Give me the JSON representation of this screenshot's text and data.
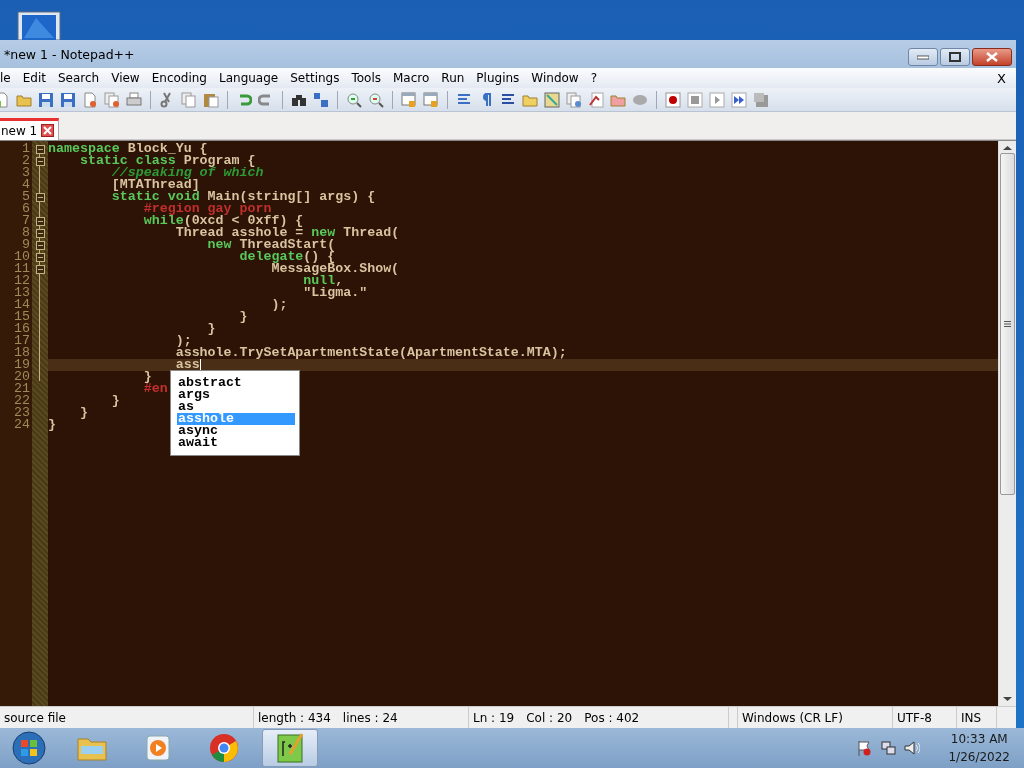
{
  "window": {
    "title": "*new 1 - Notepad++"
  },
  "menu": [
    "le",
    "Edit",
    "Search",
    "View",
    "Encoding",
    "Language",
    "Settings",
    "Tools",
    "Macro",
    "Run",
    "Plugins",
    "Window",
    "?"
  ],
  "close_document": "X",
  "tabs": [
    {
      "label": "new 1",
      "selected": true
    }
  ],
  "lines": [
    {
      "number": "1",
      "fold": true,
      "current": false,
      "tokens": [
        {
          "kind": "keyword",
          "text": "namespace"
        },
        {
          "kind": "plain",
          "text": " Block_Yu {"
        }
      ]
    },
    {
      "number": "2",
      "fold": true,
      "current": false,
      "tokens": [
        {
          "kind": "keyword",
          "text": "    static class"
        },
        {
          "kind": "plain",
          "text": " Program {"
        }
      ]
    },
    {
      "number": "3",
      "fold": false,
      "current": false,
      "tokens": [
        {
          "kind": "comment",
          "text": "        //speaking of which"
        }
      ]
    },
    {
      "number": "4",
      "fold": false,
      "current": false,
      "tokens": [
        {
          "kind": "plain",
          "text": "        [MTAThread]"
        }
      ]
    },
    {
      "number": "5",
      "fold": true,
      "current": false,
      "tokens": [
        {
          "kind": "keyword",
          "text": "        static void"
        },
        {
          "kind": "plain",
          "text": " Main(string[] args) {"
        }
      ]
    },
    {
      "number": "6",
      "fold": false,
      "current": false,
      "tokens": [
        {
          "kind": "preprocessor",
          "text": "            #region gay porn"
        }
      ]
    },
    {
      "number": "7",
      "fold": true,
      "current": false,
      "tokens": [
        {
          "kind": "keyword",
          "text": "            while"
        },
        {
          "kind": "plain",
          "text": "(0xcd < 0xff) {"
        }
      ]
    },
    {
      "number": "8",
      "fold": true,
      "current": false,
      "tokens": [
        {
          "kind": "plain",
          "text": "                Thread asshole = "
        },
        {
          "kind": "keyword",
          "text": "new"
        },
        {
          "kind": "plain",
          "text": " Thread("
        }
      ]
    },
    {
      "number": "9",
      "fold": true,
      "current": false,
      "tokens": [
        {
          "kind": "keyword",
          "text": "                    new"
        },
        {
          "kind": "plain",
          "text": " ThreadStart("
        }
      ]
    },
    {
      "number": "10",
      "fold": true,
      "current": false,
      "tokens": [
        {
          "kind": "keyword",
          "text": "                        delegate"
        },
        {
          "kind": "plain",
          "text": "() {"
        }
      ]
    },
    {
      "number": "11",
      "fold": true,
      "current": false,
      "tokens": [
        {
          "kind": "plain",
          "text": "                            MessageBox.Show("
        }
      ]
    },
    {
      "number": "12",
      "fold": false,
      "current": false,
      "tokens": [
        {
          "kind": "keyword",
          "text": "                                null"
        },
        {
          "kind": "plain",
          "text": ","
        }
      ]
    },
    {
      "number": "13",
      "fold": false,
      "current": false,
      "tokens": [
        {
          "kind": "plain",
          "text": "                                \"Ligma.\""
        }
      ]
    },
    {
      "number": "14",
      "fold": false,
      "current": false,
      "tokens": [
        {
          "kind": "plain",
          "text": "                            );"
        }
      ]
    },
    {
      "number": "15",
      "fold": false,
      "current": false,
      "tokens": [
        {
          "kind": "plain",
          "text": "                        }"
        }
      ]
    },
    {
      "number": "16",
      "fold": false,
      "current": false,
      "tokens": [
        {
          "kind": "plain",
          "text": "                    }"
        }
      ]
    },
    {
      "number": "17",
      "fold": false,
      "current": false,
      "tokens": [
        {
          "kind": "plain",
          "text": "                );"
        }
      ]
    },
    {
      "number": "18",
      "fold": false,
      "current": false,
      "tokens": [
        {
          "kind": "plain",
          "text": "                asshole.TrySetApartmentState(ApartmentState.MTA);"
        }
      ]
    },
    {
      "number": "19",
      "fold": false,
      "current": true,
      "tokens": [
        {
          "kind": "plain",
          "text": "                ass"
        }
      ]
    },
    {
      "number": "20",
      "fold": false,
      "current": false,
      "tokens": [
        {
          "kind": "plain",
          "text": "            }"
        }
      ]
    },
    {
      "number": "21",
      "fold": false,
      "current": false,
      "tokens": [
        {
          "kind": "preprocessor",
          "text": "            #en"
        }
      ]
    },
    {
      "number": "22",
      "fold": false,
      "current": false,
      "tokens": [
        {
          "kind": "plain",
          "text": "        }"
        }
      ]
    },
    {
      "number": "23",
      "fold": false,
      "current": false,
      "tokens": [
        {
          "kind": "plain",
          "text": "    }"
        }
      ]
    },
    {
      "number": "24",
      "fold": false,
      "current": false,
      "tokens": [
        {
          "kind": "plain",
          "text": "}"
        }
      ]
    }
  ],
  "autocomplete": [
    {
      "label": "abstract",
      "selected": false
    },
    {
      "label": "args",
      "selected": false
    },
    {
      "label": "as",
      "selected": false
    },
    {
      "label": "asshole",
      "selected": true
    },
    {
      "label": "async",
      "selected": false
    },
    {
      "label": "await",
      "selected": false
    }
  ],
  "status_bar": {
    "file_type": "source file",
    "length": "length : 434",
    "lines": "lines : 24",
    "line": "Ln : 19",
    "column": "Col : 20",
    "position": "Pos : 402",
    "eol": "Windows (CR LF)",
    "encoding": "UTF-8",
    "mode": "INS"
  },
  "taskbar": {
    "time": "10:33 AM",
    "date": "1/26/2022"
  }
}
